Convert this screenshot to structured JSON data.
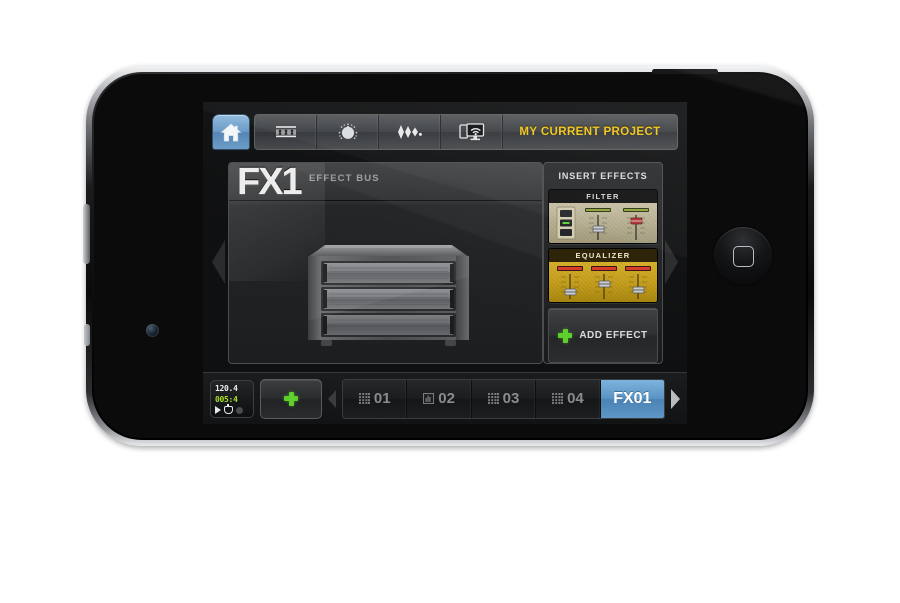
{
  "app": {
    "device": "iphone-4-landscape",
    "project_label": "MY CURRENT PROJECT",
    "accent_blue": "#5b94c4",
    "accent_yellow": "#f0c419",
    "accent_green": "#5fcf2e"
  },
  "toolbar": {
    "home_icon": "house-icon",
    "buttons": [
      {
        "icon": "mixer-faders-icon",
        "name": "mixer"
      },
      {
        "icon": "knob-icon",
        "name": "instrument"
      },
      {
        "icon": "waveform-icon",
        "name": "waveform"
      },
      {
        "icon": "devices-sync-icon",
        "name": "sync"
      }
    ],
    "project_label": "MY CURRENT PROJECT"
  },
  "main": {
    "fx_title": "FX1",
    "fx_subtitle": "EFFECT BUS",
    "rack_icon": "rack-unit-icon",
    "nav_left": "prev-arrow",
    "nav_right": "next-arrow"
  },
  "inserts": {
    "title": "INSERT EFFECTS",
    "modules": [
      {
        "label": "FILTER",
        "color": "#b5ad8e",
        "sliders": 2,
        "buttons": 3
      },
      {
        "label": "EQUALIZER",
        "color": "#c49d1c",
        "sliders": 3,
        "buttons": 0
      }
    ],
    "add_effect_label": "ADD EFFECT",
    "add_effect_icon": "plus-icon"
  },
  "transport": {
    "bpm": "120.4",
    "position": "005:4",
    "play_icon": "play-icon",
    "record_icon": "record-icon",
    "status_icon": "status-dot-icon"
  },
  "tracks": {
    "add_label": "+",
    "add_icon": "plus-icon",
    "scroll_left_icon": "chevron-left-icon",
    "scroll_right_icon": "chevron-right-icon",
    "items": [
      {
        "label": "01",
        "icon": "grid-dots-icon",
        "active": false
      },
      {
        "label": "02",
        "icon": "waveform-box-icon",
        "active": false
      },
      {
        "label": "03",
        "icon": "grid-dots-icon",
        "active": false
      },
      {
        "label": "04",
        "icon": "grid-dots-icon",
        "active": false
      },
      {
        "label": "FX01",
        "icon": "none",
        "active": true
      }
    ]
  }
}
